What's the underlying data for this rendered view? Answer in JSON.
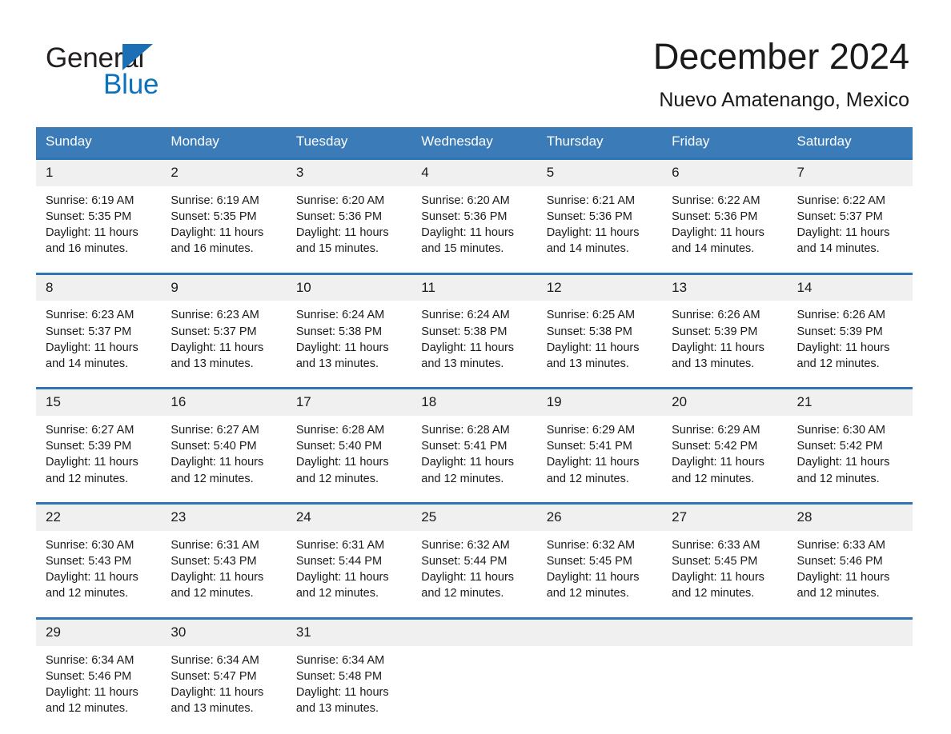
{
  "brand": {
    "name_part1": "General",
    "name_part2": "Blue",
    "triangle_color": "#1c6fb4",
    "blue_color": "#0b72bb"
  },
  "header": {
    "month_title": "December 2024",
    "location": "Nuevo Amatenango, Mexico"
  },
  "theme": {
    "header_blue": "#3b7cb8",
    "separator_blue": "#2e75b6",
    "daynum_band": "#f0f0f0"
  },
  "calendar": {
    "weekday_headers": [
      "Sunday",
      "Monday",
      "Tuesday",
      "Wednesday",
      "Thursday",
      "Friday",
      "Saturday"
    ],
    "weeks": [
      [
        {
          "day": "1",
          "sunrise": "Sunrise: 6:19 AM",
          "sunset": "Sunset: 5:35 PM",
          "daylight": "Daylight: 11 hours and 16 minutes."
        },
        {
          "day": "2",
          "sunrise": "Sunrise: 6:19 AM",
          "sunset": "Sunset: 5:35 PM",
          "daylight": "Daylight: 11 hours and 16 minutes."
        },
        {
          "day": "3",
          "sunrise": "Sunrise: 6:20 AM",
          "sunset": "Sunset: 5:36 PM",
          "daylight": "Daylight: 11 hours and 15 minutes."
        },
        {
          "day": "4",
          "sunrise": "Sunrise: 6:20 AM",
          "sunset": "Sunset: 5:36 PM",
          "daylight": "Daylight: 11 hours and 15 minutes."
        },
        {
          "day": "5",
          "sunrise": "Sunrise: 6:21 AM",
          "sunset": "Sunset: 5:36 PM",
          "daylight": "Daylight: 11 hours and 14 minutes."
        },
        {
          "day": "6",
          "sunrise": "Sunrise: 6:22 AM",
          "sunset": "Sunset: 5:36 PM",
          "daylight": "Daylight: 11 hours and 14 minutes."
        },
        {
          "day": "7",
          "sunrise": "Sunrise: 6:22 AM",
          "sunset": "Sunset: 5:37 PM",
          "daylight": "Daylight: 11 hours and 14 minutes."
        }
      ],
      [
        {
          "day": "8",
          "sunrise": "Sunrise: 6:23 AM",
          "sunset": "Sunset: 5:37 PM",
          "daylight": "Daylight: 11 hours and 14 minutes."
        },
        {
          "day": "9",
          "sunrise": "Sunrise: 6:23 AM",
          "sunset": "Sunset: 5:37 PM",
          "daylight": "Daylight: 11 hours and 13 minutes."
        },
        {
          "day": "10",
          "sunrise": "Sunrise: 6:24 AM",
          "sunset": "Sunset: 5:38 PM",
          "daylight": "Daylight: 11 hours and 13 minutes."
        },
        {
          "day": "11",
          "sunrise": "Sunrise: 6:24 AM",
          "sunset": "Sunset: 5:38 PM",
          "daylight": "Daylight: 11 hours and 13 minutes."
        },
        {
          "day": "12",
          "sunrise": "Sunrise: 6:25 AM",
          "sunset": "Sunset: 5:38 PM",
          "daylight": "Daylight: 11 hours and 13 minutes."
        },
        {
          "day": "13",
          "sunrise": "Sunrise: 6:26 AM",
          "sunset": "Sunset: 5:39 PM",
          "daylight": "Daylight: 11 hours and 13 minutes."
        },
        {
          "day": "14",
          "sunrise": "Sunrise: 6:26 AM",
          "sunset": "Sunset: 5:39 PM",
          "daylight": "Daylight: 11 hours and 12 minutes."
        }
      ],
      [
        {
          "day": "15",
          "sunrise": "Sunrise: 6:27 AM",
          "sunset": "Sunset: 5:39 PM",
          "daylight": "Daylight: 11 hours and 12 minutes."
        },
        {
          "day": "16",
          "sunrise": "Sunrise: 6:27 AM",
          "sunset": "Sunset: 5:40 PM",
          "daylight": "Daylight: 11 hours and 12 minutes."
        },
        {
          "day": "17",
          "sunrise": "Sunrise: 6:28 AM",
          "sunset": "Sunset: 5:40 PM",
          "daylight": "Daylight: 11 hours and 12 minutes."
        },
        {
          "day": "18",
          "sunrise": "Sunrise: 6:28 AM",
          "sunset": "Sunset: 5:41 PM",
          "daylight": "Daylight: 11 hours and 12 minutes."
        },
        {
          "day": "19",
          "sunrise": "Sunrise: 6:29 AM",
          "sunset": "Sunset: 5:41 PM",
          "daylight": "Daylight: 11 hours and 12 minutes."
        },
        {
          "day": "20",
          "sunrise": "Sunrise: 6:29 AM",
          "sunset": "Sunset: 5:42 PM",
          "daylight": "Daylight: 11 hours and 12 minutes."
        },
        {
          "day": "21",
          "sunrise": "Sunrise: 6:30 AM",
          "sunset": "Sunset: 5:42 PM",
          "daylight": "Daylight: 11 hours and 12 minutes."
        }
      ],
      [
        {
          "day": "22",
          "sunrise": "Sunrise: 6:30 AM",
          "sunset": "Sunset: 5:43 PM",
          "daylight": "Daylight: 11 hours and 12 minutes."
        },
        {
          "day": "23",
          "sunrise": "Sunrise: 6:31 AM",
          "sunset": "Sunset: 5:43 PM",
          "daylight": "Daylight: 11 hours and 12 minutes."
        },
        {
          "day": "24",
          "sunrise": "Sunrise: 6:31 AM",
          "sunset": "Sunset: 5:44 PM",
          "daylight": "Daylight: 11 hours and 12 minutes."
        },
        {
          "day": "25",
          "sunrise": "Sunrise: 6:32 AM",
          "sunset": "Sunset: 5:44 PM",
          "daylight": "Daylight: 11 hours and 12 minutes."
        },
        {
          "day": "26",
          "sunrise": "Sunrise: 6:32 AM",
          "sunset": "Sunset: 5:45 PM",
          "daylight": "Daylight: 11 hours and 12 minutes."
        },
        {
          "day": "27",
          "sunrise": "Sunrise: 6:33 AM",
          "sunset": "Sunset: 5:45 PM",
          "daylight": "Daylight: 11 hours and 12 minutes."
        },
        {
          "day": "28",
          "sunrise": "Sunrise: 6:33 AM",
          "sunset": "Sunset: 5:46 PM",
          "daylight": "Daylight: 11 hours and 12 minutes."
        }
      ],
      [
        {
          "day": "29",
          "sunrise": "Sunrise: 6:34 AM",
          "sunset": "Sunset: 5:46 PM",
          "daylight": "Daylight: 11 hours and 12 minutes."
        },
        {
          "day": "30",
          "sunrise": "Sunrise: 6:34 AM",
          "sunset": "Sunset: 5:47 PM",
          "daylight": "Daylight: 11 hours and 13 minutes."
        },
        {
          "day": "31",
          "sunrise": "Sunrise: 6:34 AM",
          "sunset": "Sunset: 5:48 PM",
          "daylight": "Daylight: 11 hours and 13 minutes."
        },
        {
          "day": "",
          "sunrise": "",
          "sunset": "",
          "daylight": ""
        },
        {
          "day": "",
          "sunrise": "",
          "sunset": "",
          "daylight": ""
        },
        {
          "day": "",
          "sunrise": "",
          "sunset": "",
          "daylight": ""
        },
        {
          "day": "",
          "sunrise": "",
          "sunset": "",
          "daylight": ""
        }
      ]
    ]
  }
}
